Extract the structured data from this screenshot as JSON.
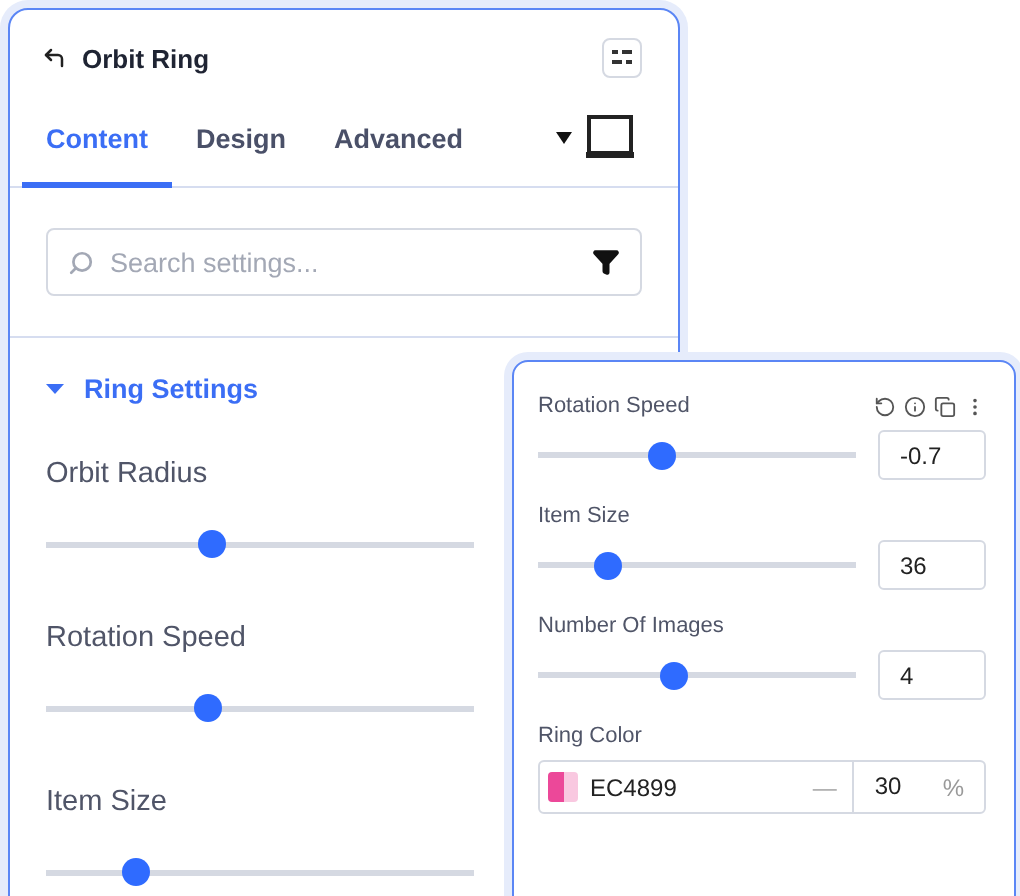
{
  "panel": {
    "title": "Orbit Ring",
    "tabs": [
      {
        "label": "Content",
        "selected": true
      },
      {
        "label": "Design",
        "selected": false
      },
      {
        "label": "Advanced",
        "selected": false
      }
    ],
    "search": {
      "placeholder": "Search settings..."
    },
    "section": {
      "title": "Ring Settings",
      "expanded": true
    },
    "controls": [
      {
        "label": "Orbit Radius",
        "level": 0.39
      },
      {
        "label": "Rotation Speed",
        "level": 0.38
      },
      {
        "label": "Item Size",
        "level": 0.21
      }
    ]
  },
  "popover": {
    "controls": [
      {
        "label": "Rotation Speed",
        "level": 0.39,
        "value": "-0.7",
        "tools": true
      },
      {
        "label": "Item Size",
        "level": 0.22,
        "value": "36",
        "tools": false
      },
      {
        "label": "Number Of Images",
        "level": 0.43,
        "value": "4",
        "tools": false
      }
    ],
    "color": {
      "label": "Ring Color",
      "hex": "EC4899",
      "separator": "—",
      "color": "#ec4899",
      "opacity": "30",
      "unit": "%"
    }
  }
}
